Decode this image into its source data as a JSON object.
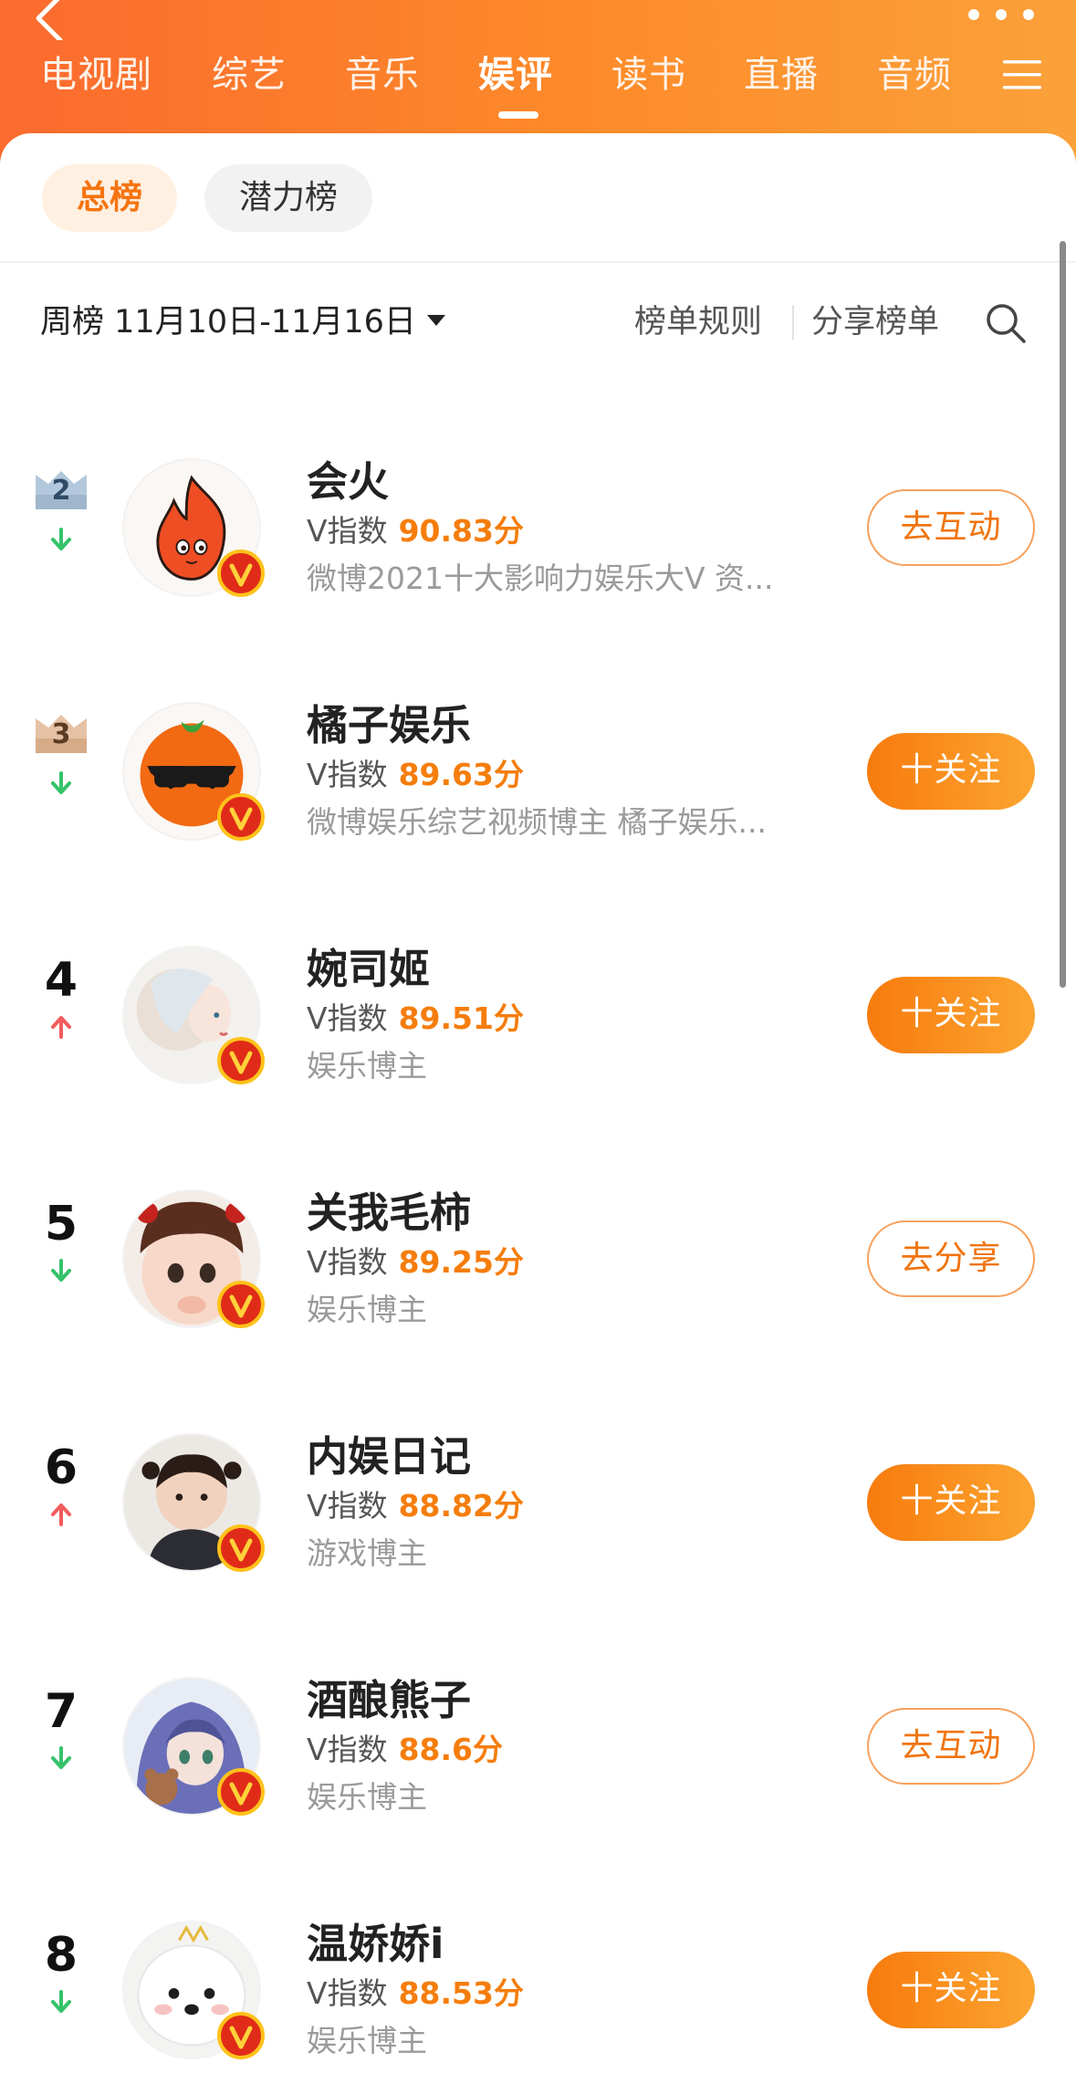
{
  "nav": {
    "back_icon": "back-chevron-icon",
    "more_icon": "more-dots-icon",
    "menu_icon": "menu-icon",
    "tabs": [
      {
        "label": "电视剧",
        "active": false
      },
      {
        "label": "综艺",
        "active": false
      },
      {
        "label": "音乐",
        "active": false
      },
      {
        "label": "娱评",
        "active": true
      },
      {
        "label": "读书",
        "active": false
      },
      {
        "label": "直播",
        "active": false
      },
      {
        "label": "音频",
        "active": false
      }
    ]
  },
  "board_tabs": [
    {
      "label": "总榜",
      "active": true
    },
    {
      "label": "潜力榜",
      "active": false
    }
  ],
  "toolbar": {
    "period_label": "周榜 11月10日-11月16日",
    "rules_label": "榜单规则",
    "share_label": "分享榜单",
    "search_icon": "search-icon"
  },
  "colors": {
    "accent": "#f57d0c",
    "header_start": "#fb6a2e",
    "header_end": "#fca13a",
    "trend_up": "#f25c5c",
    "trend_down": "#35c26a"
  },
  "score_prefix": "V指数",
  "ranking": [
    {
      "rank": "2",
      "trend": "down",
      "name": "会火",
      "score": "90.83分",
      "desc": "微博2021十大影响力娱乐大V 资...",
      "action": "去互动",
      "action_style": "outline"
    },
    {
      "rank": "3",
      "trend": "down",
      "name": "橘子娱乐",
      "score": "89.63分",
      "desc": "微博娱乐综艺视频博主 橘子娱乐...",
      "action": "十关注",
      "action_style": "follow"
    },
    {
      "rank": "4",
      "trend": "up",
      "name": "婉司姬",
      "score": "89.51分",
      "desc": "娱乐博主",
      "action": "十关注",
      "action_style": "follow"
    },
    {
      "rank": "5",
      "trend": "down",
      "name": "关我毛柿",
      "score": "89.25分",
      "desc": "娱乐博主",
      "action": "去分享",
      "action_style": "outline"
    },
    {
      "rank": "6",
      "trend": "up",
      "name": "内娱日记",
      "score": "88.82分",
      "desc": "游戏博主",
      "action": "十关注",
      "action_style": "follow"
    },
    {
      "rank": "7",
      "trend": "down",
      "name": "酒酿熊子",
      "score": "88.6分",
      "desc": "娱乐博主",
      "action": "去互动",
      "action_style": "outline"
    },
    {
      "rank": "8",
      "trend": "down",
      "name": "温娇娇i",
      "score": "88.53分",
      "desc": "娱乐博主",
      "action": "十关注",
      "action_style": "follow"
    }
  ]
}
